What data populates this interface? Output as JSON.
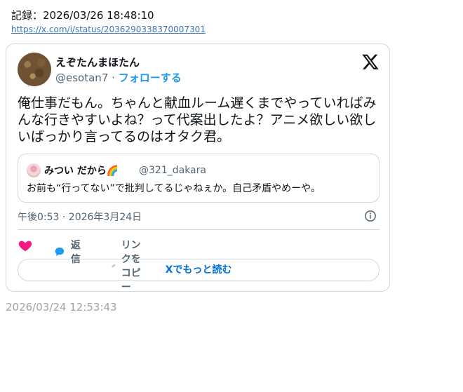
{
  "header": {
    "record": "記録：2026/03/26 18:48:10",
    "link": "https://x.com/i/status/2036290338370007301"
  },
  "tweet": {
    "author_name": "えぞたんまほたん",
    "author_handle": "@esotan7",
    "separator": "·",
    "follow_label": "フォローする",
    "text": "俺仕事だもん。ちゃんと献血ルーム遅くまでやっていればみんな行きやすいよね？って代案出したよ？アニメ欲しい欲しいばっかり言ってるのはオタク君。",
    "quote": {
      "name": "みつい だから🌈",
      "handle": "@321_dakara",
      "text": "お前も“行ってない”で批判してるじゃねぇか。自己矛盾やめーや。"
    },
    "timestamp": "午後0:53 · 2026年3月24日",
    "actions": {
      "reply": "返信",
      "copy_link": "リンクをコピー"
    },
    "read_more": "Xでもっと読む"
  },
  "footer": {
    "time": "2026/03/24 12:53:43"
  },
  "colors": {
    "accent": "#1d9bf0",
    "like": "#f91880",
    "link": "#006fd6",
    "muted": "#536471"
  },
  "icons": [
    "x-logo-icon",
    "info-icon",
    "heart-icon",
    "reply-icon",
    "link-icon"
  ]
}
